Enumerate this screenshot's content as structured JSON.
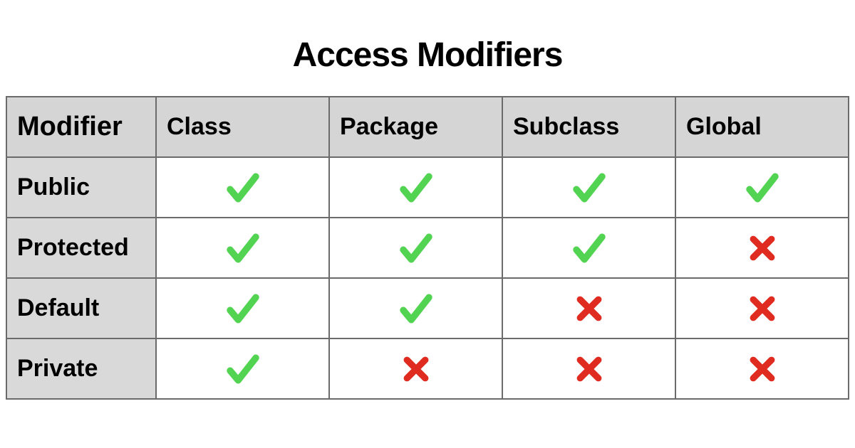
{
  "title": "Access Modifiers",
  "columns": [
    "Modifier",
    "Class",
    "Package",
    "Subclass",
    "Global"
  ],
  "rows": [
    {
      "label": "Public",
      "cells": [
        "check",
        "check",
        "check",
        "check"
      ]
    },
    {
      "label": "Protected",
      "cells": [
        "check",
        "check",
        "check",
        "cross"
      ]
    },
    {
      "label": "Default",
      "cells": [
        "check",
        "check",
        "cross",
        "cross"
      ]
    },
    {
      "label": "Private",
      "cells": [
        "check",
        "cross",
        "cross",
        "cross"
      ]
    }
  ],
  "icons": {
    "check": {
      "color": "#52d452"
    },
    "cross": {
      "color": "#e02b20"
    }
  },
  "chart_data": {
    "type": "table",
    "title": "Access Modifiers",
    "columns": [
      "Modifier",
      "Class",
      "Package",
      "Subclass",
      "Global"
    ],
    "rows": [
      [
        "Public",
        true,
        true,
        true,
        true
      ],
      [
        "Protected",
        true,
        true,
        true,
        false
      ],
      [
        "Default",
        true,
        true,
        false,
        false
      ],
      [
        "Private",
        true,
        false,
        false,
        false
      ]
    ]
  }
}
